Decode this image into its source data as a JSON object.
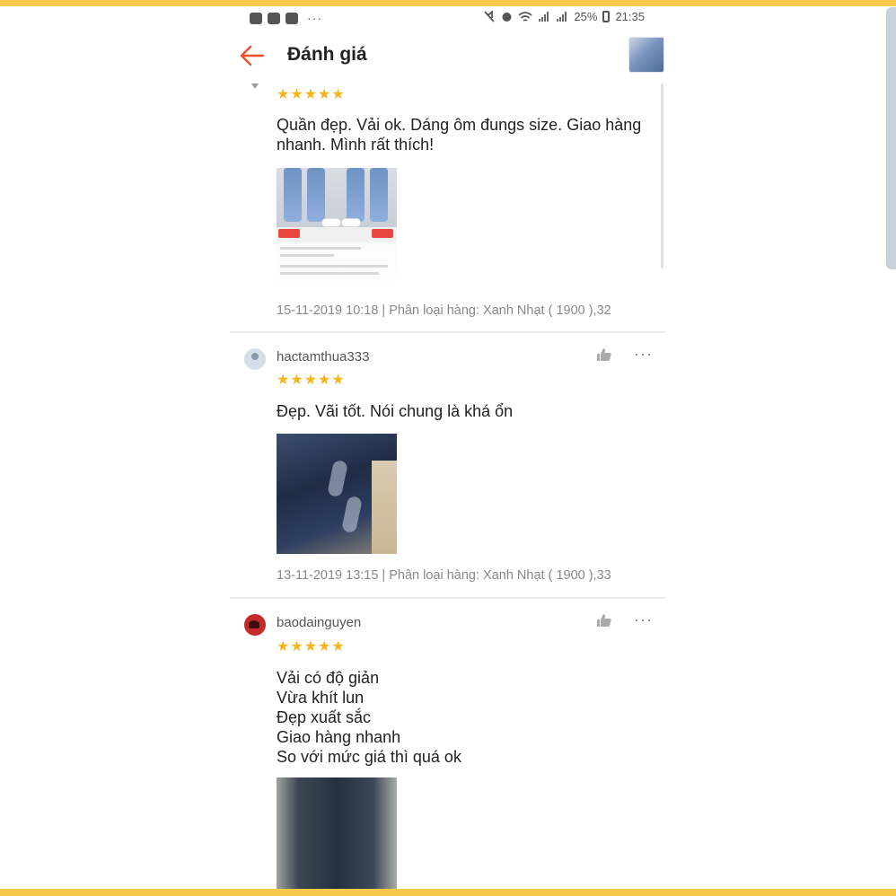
{
  "status_bar": {
    "percent": "25%",
    "time": "21:35",
    "dots": "···"
  },
  "header": {
    "title": "Đánh giá"
  },
  "reviews": [
    {
      "rating": 5,
      "stars": "★★★★★",
      "text": "Quần đẹp. Vải ok. Dáng ôm đungs size. Giao hàng\nnhanh. Mình rất thích!",
      "meta": "15-11-2019 10:18 | Phân loại hàng: Xanh Nhạt ( 1900 ),32"
    },
    {
      "username": "hactamthua333",
      "rating": 5,
      "stars": "★★★★★",
      "text": "Đẹp. Vãi tốt. Nói chung là khá ổn",
      "meta": "13-11-2019 13:15 | Phân loại hàng: Xanh Nhạt ( 1900 ),33"
    },
    {
      "username": "baodainguyen",
      "rating": 5,
      "stars": "★★★★★",
      "text": "Vải có độ giản\nVừa khít lun\nĐẹp xuất sắc\nGiao hàng nhanh\nSo với mức giá thì quá ok"
    }
  ],
  "colors": {
    "frame": "#f5c84c",
    "star": "#f5b51c",
    "back_arrow": "#ee4d2d"
  },
  "icons": [
    "back-arrow-icon",
    "thumbs-up-icon",
    "more-dots-icon",
    "avatar-icon",
    "wifi-icon",
    "signal-icon",
    "battery-icon"
  ]
}
